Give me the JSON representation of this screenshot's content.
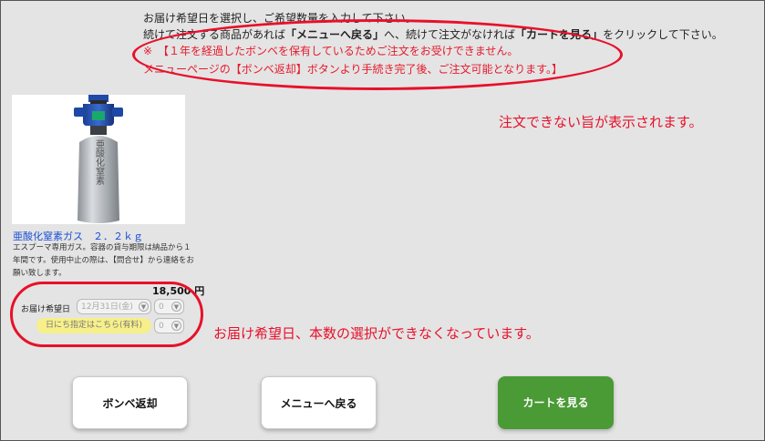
{
  "header": {
    "instruction_line1": "お届け希望日を選択し、ご希望数量を入力して下さい。",
    "instruction_line2_pre": "続けて注文する商品があれば",
    "instruction_line2_menu": "「メニューへ戻る」",
    "instruction_line2_mid": "へ、続けて注文がなければ",
    "instruction_line2_cart": "「カートを見る」",
    "instruction_line2_post": "をクリックして下さい。",
    "warning_line1": "※　【１年を経過したボンベを保有しているためご注文をお受けできません。",
    "warning_line2": "メニューページの【ボンベ返却】ボタンより手続き完了後、ご注文可能となります。】"
  },
  "annotations": {
    "cannot_order_note": "注文できない旨が表示されます。",
    "selection_disabled_note": "お届け希望日、本数の選択ができなくなっています。"
  },
  "product": {
    "image_label": "亜酸化窒素",
    "name": "亜酸化窒素ガス　２．２ｋｇ",
    "description": "エスプーマ専用ガス。容器の貸与期限は納品から１年間です。使用中止の際は、【問合せ】から連絡をお願い致します。",
    "price": "18,500 円"
  },
  "order": {
    "date_label": "お届け希望日",
    "date_value": "12月31日(金)",
    "qty_value": "0",
    "date_specify_button": "日にち指定はこちら(有料)",
    "qty_value_2": "0"
  },
  "buttons": {
    "return_cylinder": "ボンベ返却",
    "back_to_menu": "メニューへ戻る",
    "view_cart": "カートを見る"
  },
  "colors": {
    "background": "#e4e4e4",
    "alert_red": "#e8102a",
    "cart_green": "#4a9a35",
    "link_blue": "#1a4fd6",
    "date_button_yellow": "#f7f08a"
  }
}
